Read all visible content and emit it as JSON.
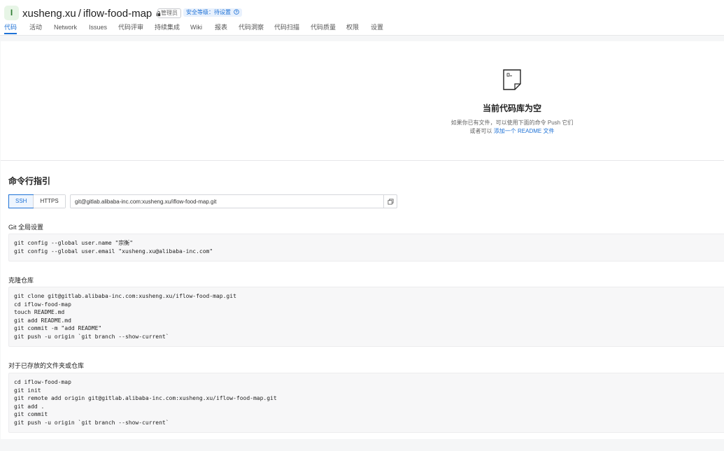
{
  "header": {
    "avatar_letter": "I",
    "owner": "xusheng.xu",
    "separator": "/",
    "repo": "iflow-food-map",
    "admin_badge": "管理员",
    "security_badge": "安全等级：待设置"
  },
  "tabs": [
    {
      "label": "代码"
    },
    {
      "label": "活动"
    },
    {
      "label": "Network"
    },
    {
      "label": "Issues"
    },
    {
      "label": "代码评审"
    },
    {
      "label": "持续集成"
    },
    {
      "label": "Wiki"
    },
    {
      "label": "报表"
    },
    {
      "label": "代码洞察"
    },
    {
      "label": "代码扫描"
    },
    {
      "label": "代码质量"
    },
    {
      "label": "权限"
    },
    {
      "label": "设置"
    }
  ],
  "empty": {
    "title": "当前代码库为空",
    "line1": "如果你已有文件，可以使用下面的命令 Push 它们",
    "line2_prefix": "或者可以 ",
    "line2_link": "添加一个 README 文件"
  },
  "guide": {
    "title": "命令行指引",
    "ssh_label": "SSH",
    "https_label": "HTTPS",
    "repo_url": "git@gitlab.alibaba-inc.com:xusheng.xu/iflow-food-map.git",
    "global_label": "Git 全局设置",
    "global_cmds": [
      "git config --global user.name \"宗衡\"",
      "git config --global user.email \"xusheng.xu@alibaba-inc.com\""
    ],
    "clone_label": "克隆仓库",
    "clone_cmds": [
      "git clone git@gitlab.alibaba-inc.com:xusheng.xu/iflow-food-map.git",
      "cd iflow-food-map",
      "touch README.md",
      "git add README.md",
      "git commit -m \"add README\"",
      "git push -u origin `git branch --show-current`"
    ],
    "existing_label": "对于已存放的文件夹或仓库",
    "existing_cmds": [
      "cd iflow-food-map",
      "git init",
      "git remote add origin git@gitlab.alibaba-inc.com:xusheng.xu/iflow-food-map.git",
      "git add .",
      "git commit",
      "git push -u origin `git branch --show-current`"
    ]
  },
  "colors": {
    "accent": "#1f72d6",
    "avatar_bg": "#e7f5e6",
    "code_bg": "#f7f7f8"
  }
}
